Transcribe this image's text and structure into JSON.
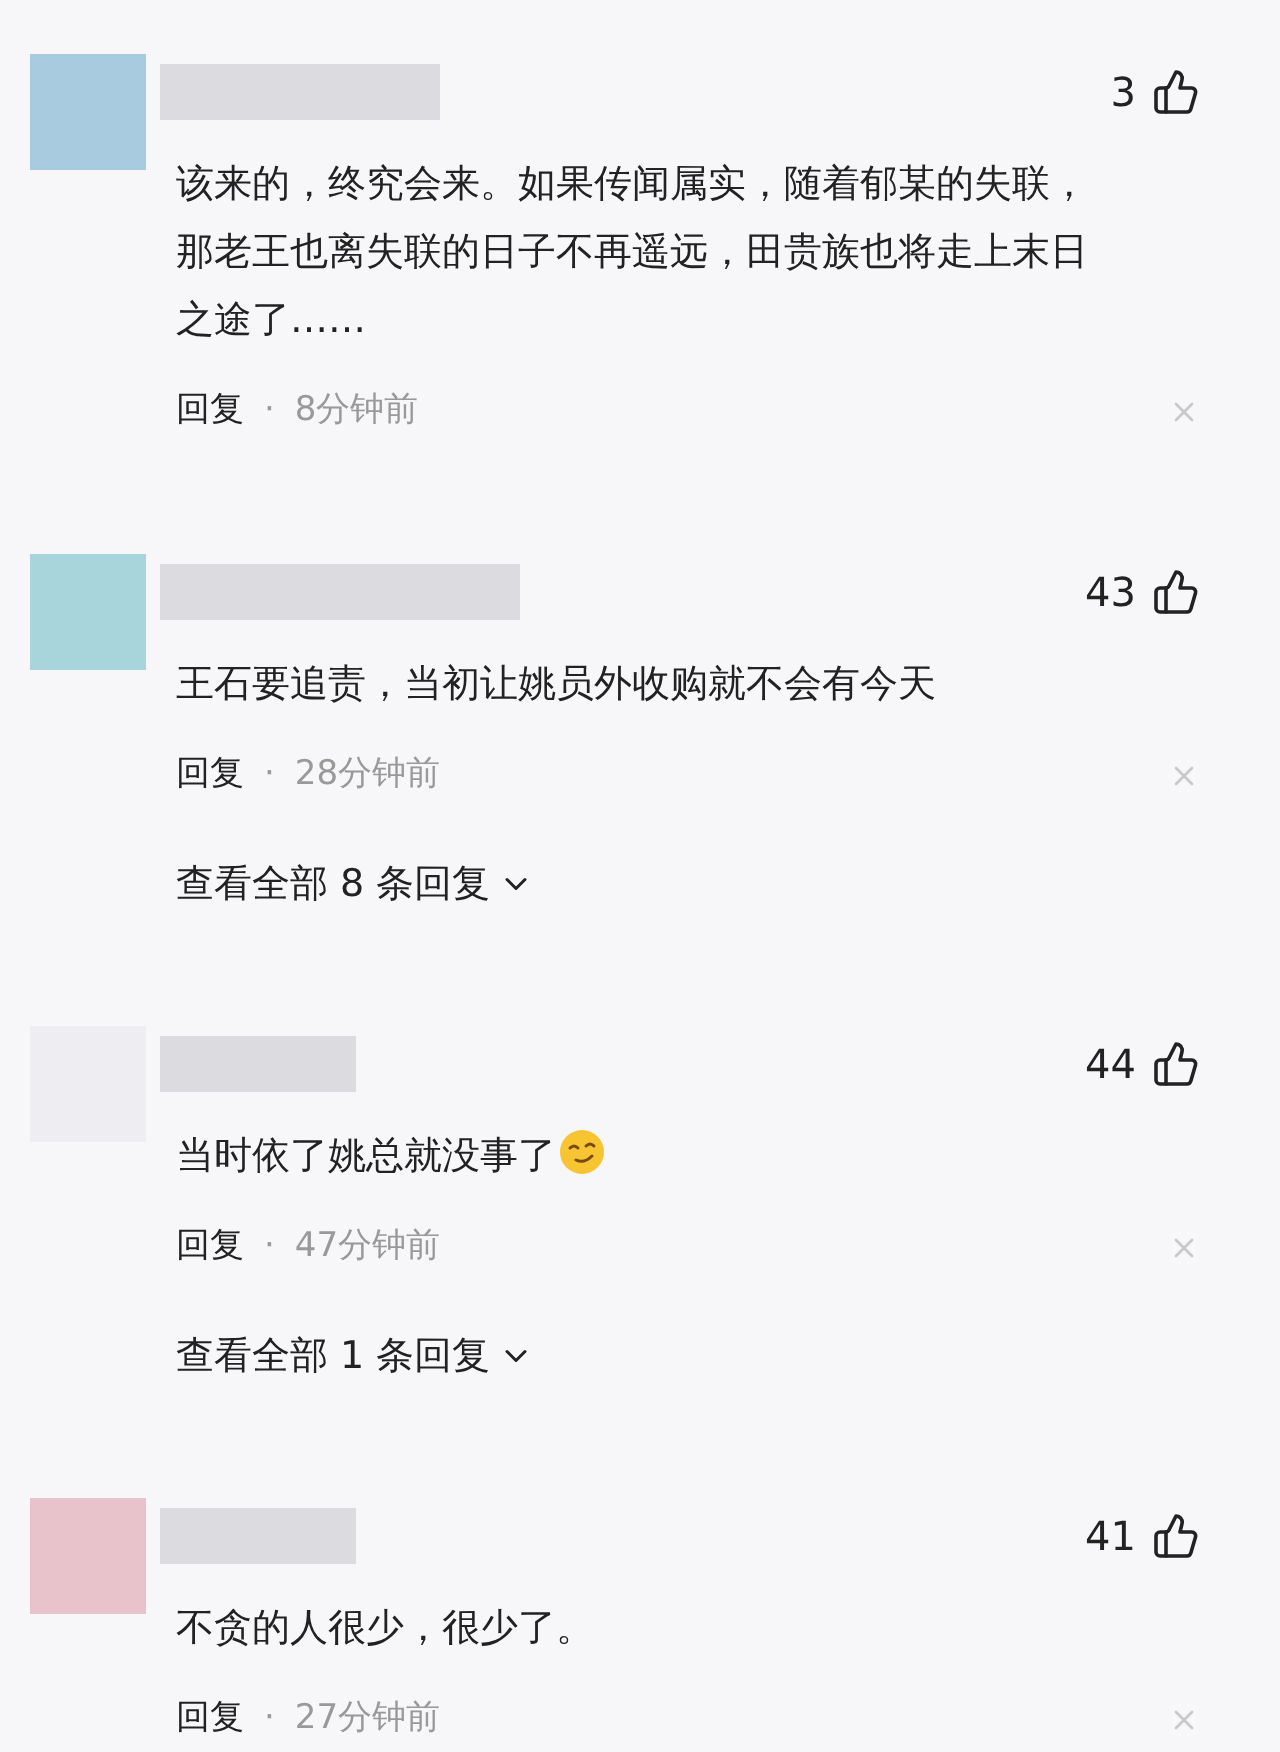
{
  "comments": [
    {
      "color": "#a9cbe0",
      "likes": "3",
      "text": "该来的，终究会来。如果传闻属实，随着郁某的失联，那老王也离失联的日子不再遥远，田贵族也将走上末日之途了……",
      "emoji": false,
      "reply_label": "回复",
      "separator": "·",
      "time": "8分钟前"
    },
    {
      "color": "#a8d4dc",
      "likes": "43",
      "text": "王石要追责，当初让姚员外收购就不会有今天",
      "emoji": false,
      "reply_label": "回复",
      "separator": "·",
      "time": "28分钟前",
      "view_replies": "查看全部 8 条回复"
    },
    {
      "color": "#eeeef2",
      "likes": "44",
      "text": "当时依了姚总就没事了",
      "emoji": true,
      "reply_label": "回复",
      "separator": "·",
      "time": "47分钟前",
      "view_replies": "查看全部 1 条回复"
    },
    {
      "color": "#e8c3cb",
      "likes": "41",
      "text": "不贪的人很少，很少了。",
      "emoji": false,
      "reply_label": "回复",
      "separator": "·",
      "time": "27分钟前"
    }
  ]
}
